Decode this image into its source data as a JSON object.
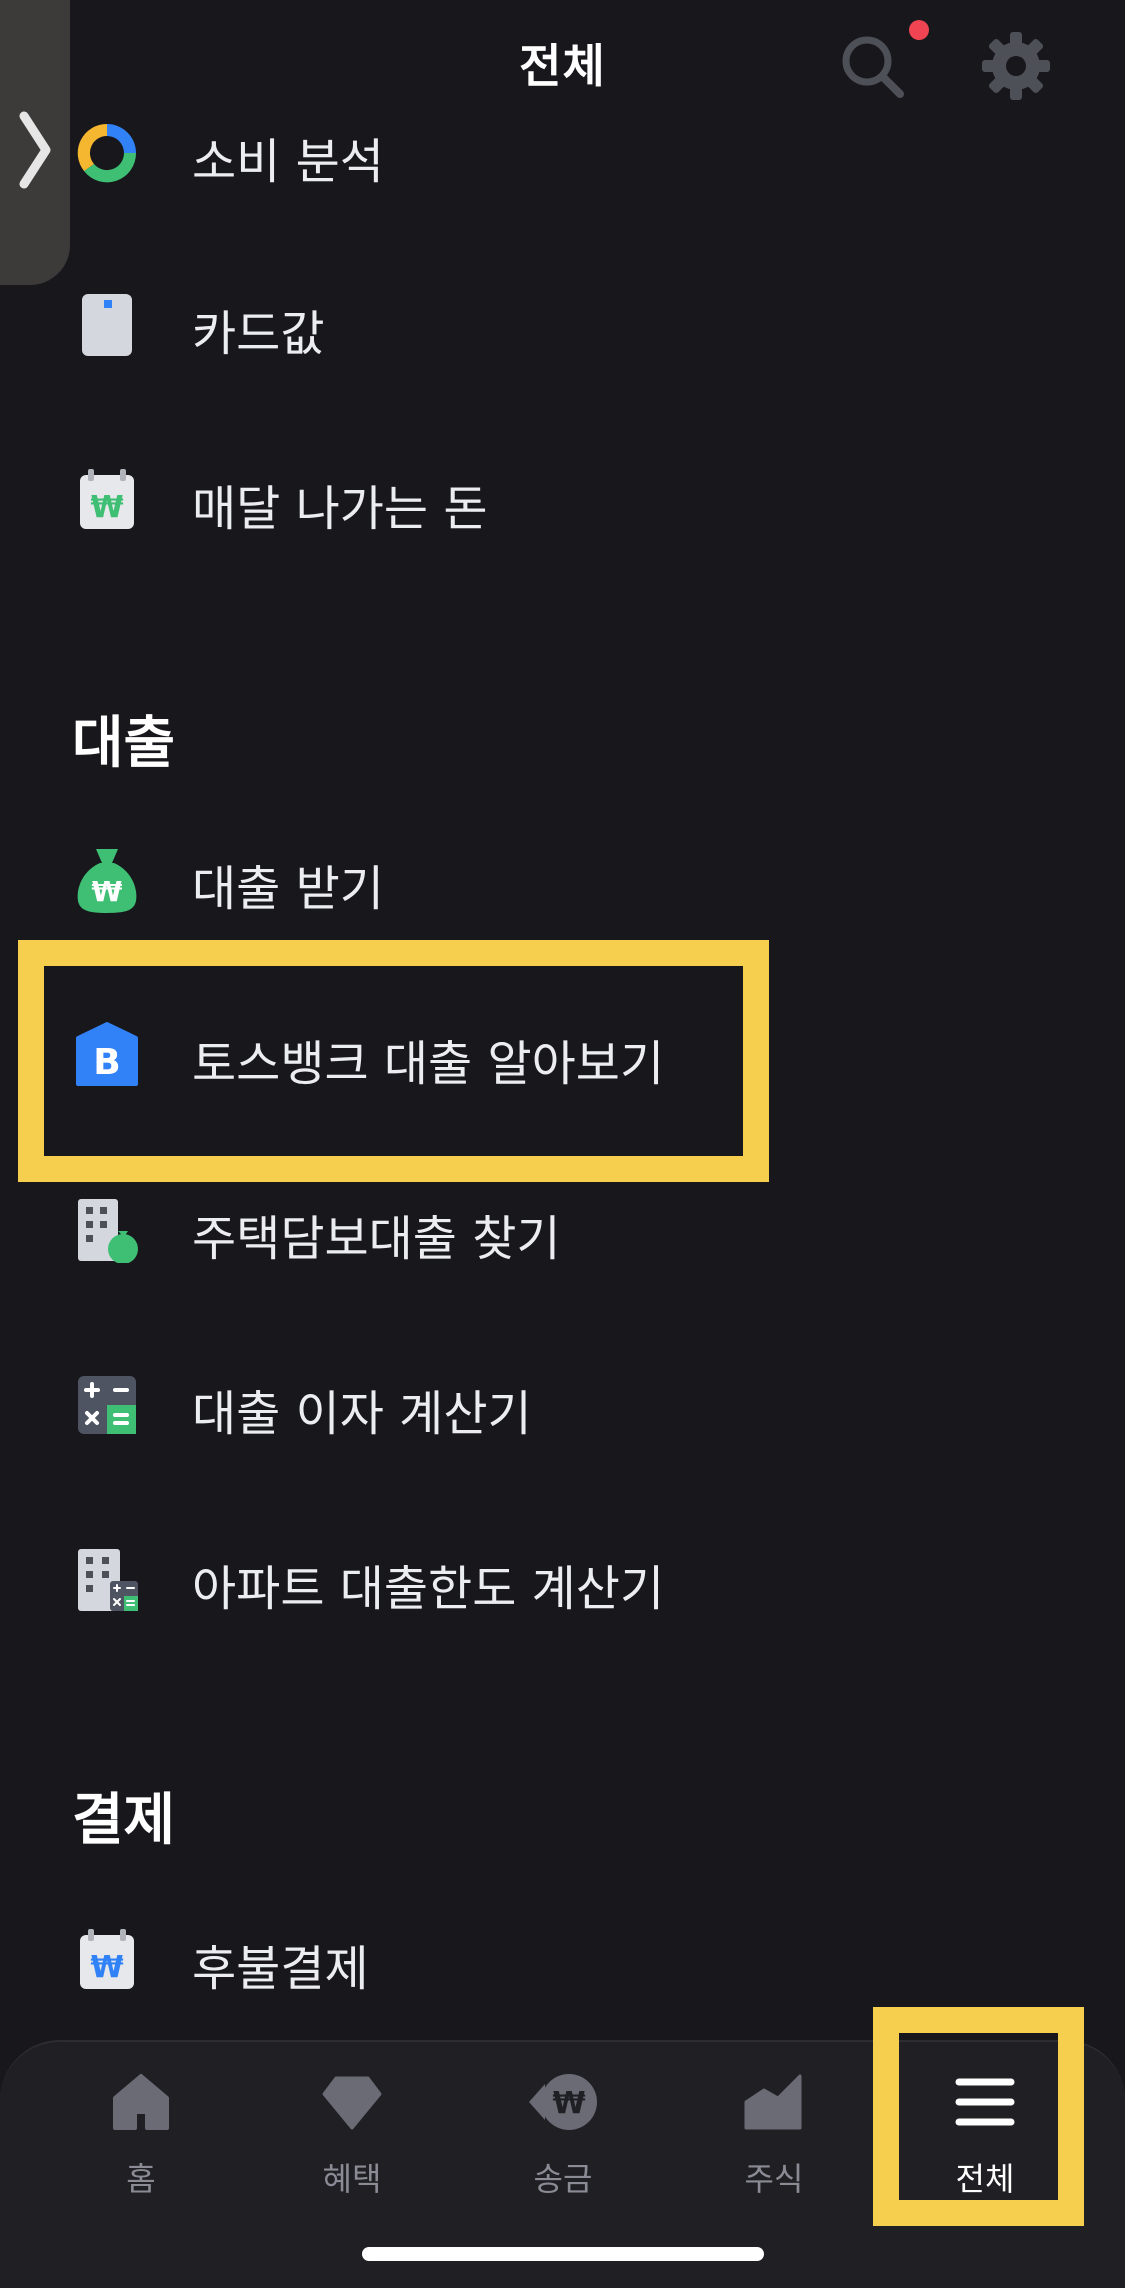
{
  "header": {
    "title": "전체",
    "icons": {
      "search": "search-icon",
      "settings": "gear-icon",
      "notification": "notification-dot"
    }
  },
  "side_handle": {
    "icon": "chevron-right-icon"
  },
  "menu": {
    "top_items": [
      {
        "label": "소비 분석",
        "icon": "donut-chart-icon"
      },
      {
        "label": "카드값",
        "icon": "card-icon"
      },
      {
        "label": "매달 나가는 돈",
        "icon": "calendar-won-icon"
      }
    ],
    "sections": [
      {
        "title": "대출",
        "items": [
          {
            "label": "대출 받기",
            "icon": "money-bag-icon"
          },
          {
            "label": "토스뱅크 대출 알아보기",
            "icon": "tossbank-icon",
            "icon_text": "B"
          },
          {
            "label": "주택담보대출 찾기",
            "icon": "building-money-icon"
          },
          {
            "label": "대출 이자 계산기",
            "icon": "calculator-icon"
          },
          {
            "label": "아파트 대출한도 계산기",
            "icon": "apartment-calculator-icon"
          }
        ]
      },
      {
        "title": "결제",
        "items": [
          {
            "label": "후불결제",
            "icon": "calendar-won-blue-icon"
          }
        ]
      }
    ]
  },
  "tabbar": {
    "tabs": [
      {
        "label": "홈",
        "icon": "home-icon",
        "active": false
      },
      {
        "label": "혜택",
        "icon": "diamond-icon",
        "active": false
      },
      {
        "label": "송금",
        "icon": "won-transfer-icon",
        "active": false
      },
      {
        "label": "주식",
        "icon": "stock-chart-icon",
        "active": false
      },
      {
        "label": "전체",
        "icon": "menu-icon",
        "active": true
      }
    ]
  },
  "colors": {
    "background": "#17171c",
    "tabbar_background": "#1f1f24",
    "highlight": "#f7cf4f",
    "text_primary": "#ffffff",
    "text_secondary": "#ecedf0",
    "tab_inactive": "#8b8b95",
    "green_icon": "#3fbf73",
    "blue_icon": "#3182f6",
    "notification": "#f04452"
  }
}
